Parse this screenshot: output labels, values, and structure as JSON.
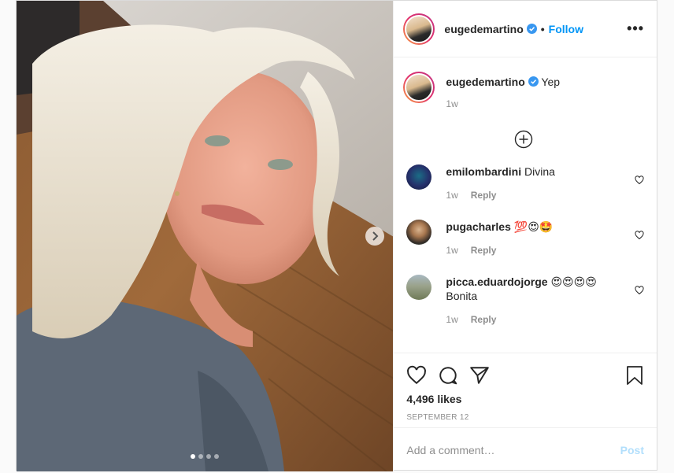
{
  "post": {
    "author": "eugedemartino",
    "follow_label": "Follow",
    "separator": "•",
    "more_label": "•••",
    "caption_text": "Yep",
    "caption_time": "1w",
    "carousel": {
      "total": 4,
      "current": 1
    }
  },
  "comments": [
    {
      "user": "emilombardini",
      "text": "Divina",
      "second_line": "",
      "time": "1w",
      "reply_label": "Reply"
    },
    {
      "user": "pugacharles",
      "text": "💯😍🤩",
      "second_line": "",
      "time": "1w",
      "reply_label": "Reply"
    },
    {
      "user": "picca.eduardojorge",
      "text": "😍😍😍😍",
      "second_line": "Bonita",
      "time": "1w",
      "reply_label": "Reply"
    }
  ],
  "engagement": {
    "likes": "4,496 likes",
    "date": "SEPTEMBER 12"
  },
  "comment_box": {
    "placeholder": "Add a comment…",
    "post_label": "Post"
  },
  "colors": {
    "accent": "#0095f6",
    "muted": "#8e8e8e",
    "post_disabled": "#b2dffc"
  }
}
